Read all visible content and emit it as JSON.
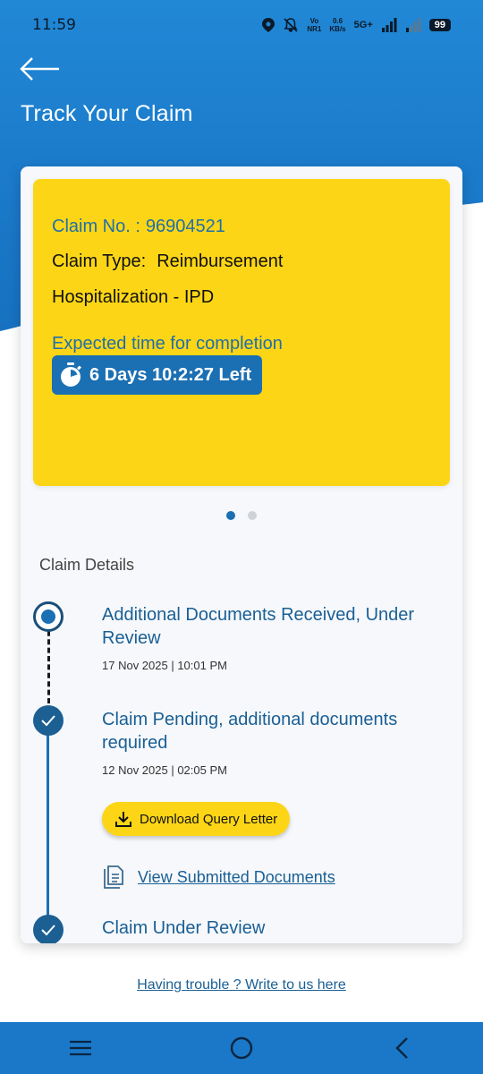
{
  "status_bar": {
    "time": "11:59",
    "network_top": "Vo",
    "network_bottom": "NR1",
    "speed_top": "0.6",
    "speed_bottom": "KB/s",
    "network_type": "5G+",
    "battery": "99"
  },
  "header": {
    "title": "Track Your Claim",
    "back_icon": "arrow-left-icon",
    "accent_color": "#1b78c8"
  },
  "claim_card": {
    "claim_no_label": "Claim No. :",
    "claim_no": "96904521",
    "claim_type_label": "Claim Type:",
    "claim_type": "Reimbursement",
    "claim_subtype": "Hospitalization - IPD",
    "expected_label": "Expected time for completion",
    "time_left": "6 Days 10:2:27 Left",
    "timer_icon": "stopwatch-icon",
    "card_color": "#fcd616"
  },
  "carousel": {
    "total": 2,
    "active": 1
  },
  "details": {
    "section_title": "Claim Details",
    "steps": [
      {
        "title": "Additional Documents Received, Under Review",
        "date": "17 Nov 2025 | 10:01 PM",
        "state": "current"
      },
      {
        "title": "Claim Pending, additional documents required",
        "date": "12 Nov 2025 | 02:05 PM",
        "state": "done"
      },
      {
        "title": "Claim Under Review",
        "state": "done"
      }
    ],
    "download_label": "Download Query Letter",
    "view_docs_label": "View Submitted Documents"
  },
  "footer": {
    "help_link": "Having trouble ? Write to us here"
  },
  "nav": {
    "recent_icon": "menu-icon",
    "home_icon": "home-circle-icon",
    "back_icon": "back-chevron-icon"
  }
}
